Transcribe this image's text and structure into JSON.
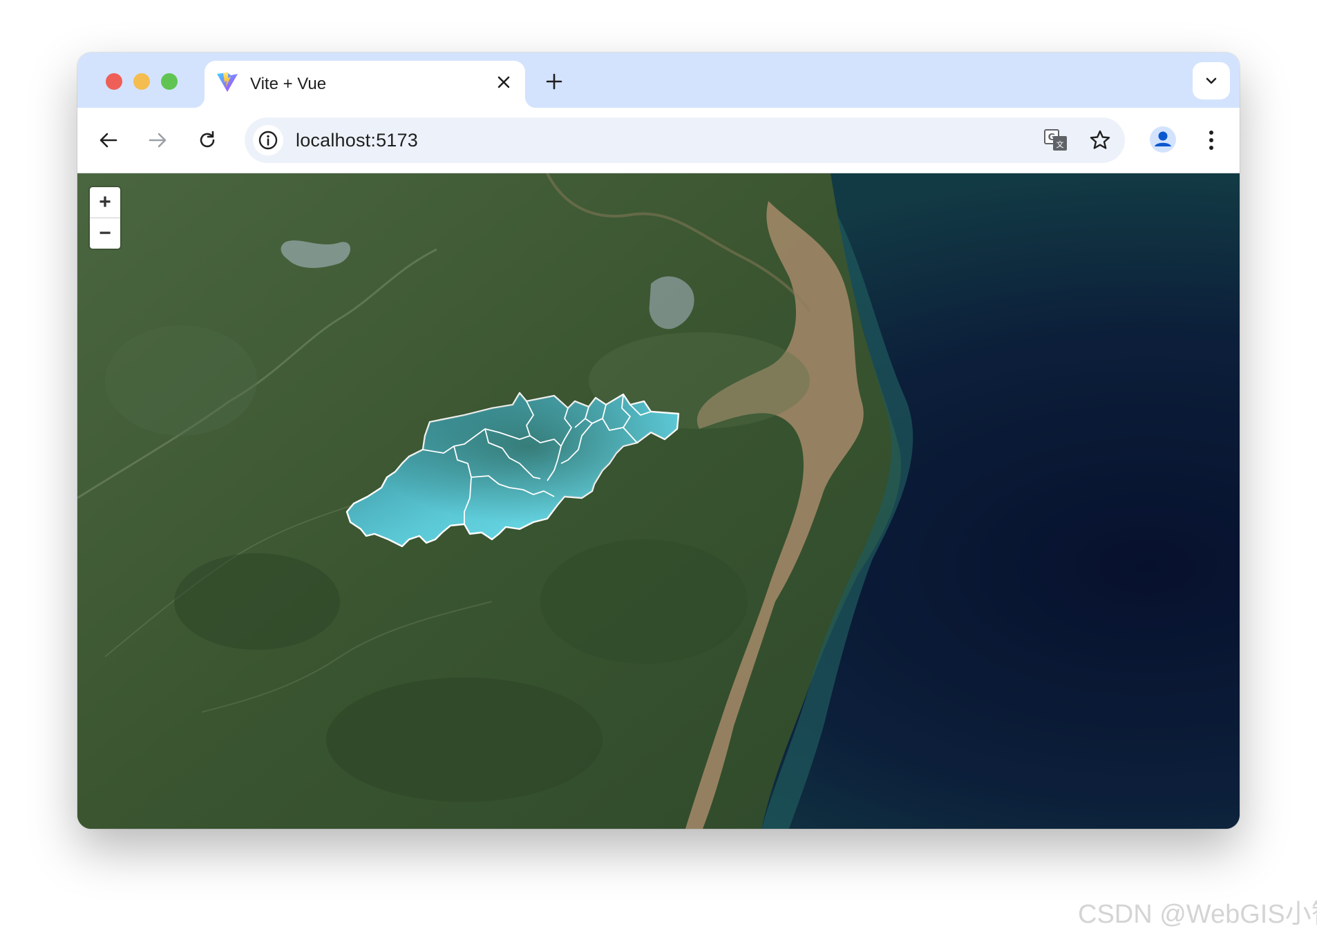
{
  "browser": {
    "tab": {
      "title": "Vite + Vue",
      "favicon": "vite-logo-icon"
    },
    "address_bar": {
      "url": "localhost:5173"
    },
    "icons": {
      "back": "arrow-left-icon",
      "forward": "arrow-right-icon",
      "reload": "reload-icon",
      "site_info": "info-icon",
      "translate": "translate-icon",
      "bookmark": "star-icon",
      "profile": "profile-avatar-icon",
      "menu": "kebab-menu-icon",
      "new_tab": "plus-icon",
      "tab_search": "chevron-down-icon",
      "close_tab": "close-icon"
    }
  },
  "map": {
    "zoom_in_label": "+",
    "zoom_out_label": "−",
    "highlight_color": "#6fe0ee",
    "region_border_color": "#ffffff"
  },
  "watermark": "CSDN @WebGIS小智"
}
